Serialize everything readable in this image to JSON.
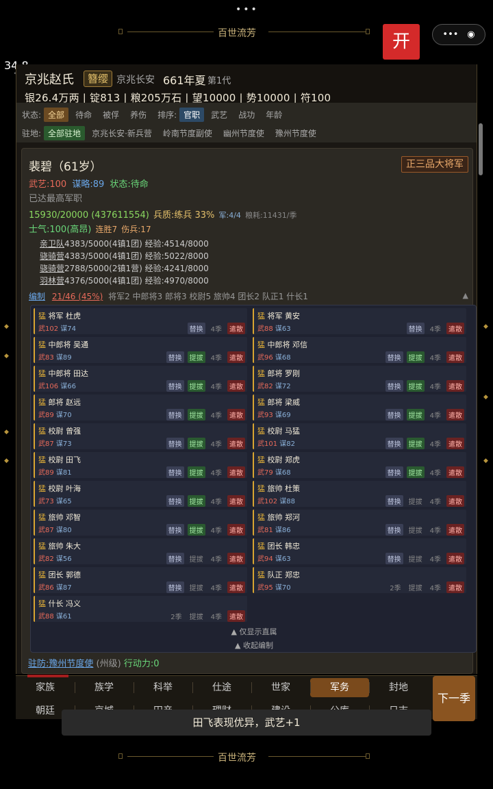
{
  "top": {
    "menu_dots": "•••",
    "title": "百世流芳",
    "open_button": "开",
    "capsule_more": "•••",
    "capsule_close": "◉",
    "temperature": "34.8",
    "temp_unit": "°C"
  },
  "header": {
    "clan": "京兆赵氏",
    "tag": "簪缨",
    "location": "京兆长安",
    "year": "661年夏",
    "generation": "第1代",
    "resources": "银26.4万两 | 锭813 | 粮205万石 | 望10000 | 势10000 | 符100"
  },
  "filters": {
    "status_label": "状态:",
    "status": [
      "全部",
      "待命",
      "被俘",
      "养伤"
    ],
    "sort_label": "排序:",
    "sort": [
      "官职",
      "武艺",
      "战功",
      "年龄"
    ],
    "garrison_label": "驻地:",
    "garrison": [
      "全部驻地",
      "京兆长安·新兵营",
      "岭南节度副使",
      "幽州节度使",
      "豫州节度使"
    ]
  },
  "general": {
    "name": "裴碧（61岁）",
    "rank": "正三品大将军",
    "wuyi": "武艺:100",
    "moulue": "谋略:89",
    "state": "状态:待命",
    "note": "已达最高军职",
    "troops_line": "15930/20000 (437611554)",
    "quality": "兵质:练兵 33%",
    "army": "军:4/4",
    "grain": "粮耗:11431/季",
    "morale": "士气:100(高昂)",
    "streak": "连胜7",
    "wounded": "伤兵:17",
    "units": [
      {
        "name": "亲卫队",
        "text": "4383/5000(4镇1团) 经验:4514/8000"
      },
      {
        "name": "骁骑营",
        "text": "4383/5000(4镇1团) 经验:5022/8000"
      },
      {
        "name": "骁骑营",
        "text": "2788/5000(2镇1营) 经验:4241/8000"
      },
      {
        "name": "羽林营",
        "text": "4376/5000(4镇1团) 经验:4970/8000"
      }
    ],
    "org_label": "编制",
    "org_count": "21/46 (45%)",
    "org_detail": "将军2 中郎将3 郎将3 校尉5 旅帅4 团长2 队正1 什长1",
    "collapse_arrow": "▲"
  },
  "officers": [
    {
      "badge": "猛",
      "title": "将军",
      "name": "杜虎",
      "wu": "武102",
      "mou": "谋74",
      "acts": [
        "替换"
      ],
      "season": "4季",
      "dismiss": "遣散"
    },
    {
      "badge": "猛",
      "title": "将军",
      "name": "黄安",
      "wu": "武88",
      "mou": "谋63",
      "acts": [
        "替换"
      ],
      "season": "4季",
      "dismiss": "遣散"
    },
    {
      "badge": "猛",
      "title": "中郎将",
      "name": "吴通",
      "wu": "武83",
      "mou": "谋89",
      "acts": [
        "替换",
        "提拔"
      ],
      "season": "4季",
      "dismiss": "遣散"
    },
    {
      "badge": "猛",
      "title": "中郎将",
      "name": "邓信",
      "wu": "武96",
      "mou": "谋68",
      "acts": [
        "替换",
        "提拔"
      ],
      "season": "4季",
      "dismiss": "遣散"
    },
    {
      "badge": "猛",
      "title": "中郎将",
      "name": "田达",
      "wu": "武106",
      "mou": "谋66",
      "acts": [
        "替换",
        "提拔"
      ],
      "season": "4季",
      "dismiss": "遣散"
    },
    {
      "badge": "猛",
      "title": "郎将",
      "name": "罗刚",
      "wu": "武82",
      "mou": "谋72",
      "acts": [
        "替换",
        "提拔"
      ],
      "season": "4季",
      "dismiss": "遣散"
    },
    {
      "badge": "猛",
      "title": "郎将",
      "name": "赵远",
      "wu": "武89",
      "mou": "谋70",
      "acts": [
        "替换",
        "提拔"
      ],
      "season": "4季",
      "dismiss": "遣散"
    },
    {
      "badge": "猛",
      "title": "郎将",
      "name": "梁威",
      "wu": "武93",
      "mou": "谋69",
      "acts": [
        "替换",
        "提拔"
      ],
      "season": "4季",
      "dismiss": "遣散"
    },
    {
      "badge": "猛",
      "title": "校尉",
      "name": "曾强",
      "wu": "武87",
      "mou": "谋73",
      "acts": [
        "替换",
        "提拔"
      ],
      "season": "4季",
      "dismiss": "遣散"
    },
    {
      "badge": "猛",
      "title": "校尉",
      "name": "马猛",
      "wu": "武101",
      "mou": "谋82",
      "acts": [
        "替换",
        "提拔"
      ],
      "season": "4季",
      "dismiss": "遣散"
    },
    {
      "badge": "猛",
      "title": "校尉",
      "name": "田飞",
      "wu": "武89",
      "mou": "谋81",
      "acts": [
        "替换",
        "提拔"
      ],
      "season": "4季",
      "dismiss": "遣散"
    },
    {
      "badge": "猛",
      "title": "校尉",
      "name": "郑虎",
      "wu": "武79",
      "mou": "谋68",
      "acts": [
        "替换",
        "提拔"
      ],
      "season": "4季",
      "dismiss": "遣散"
    },
    {
      "badge": "猛",
      "title": "校尉",
      "name": "叶海",
      "wu": "武73",
      "mou": "谋65",
      "acts": [
        "替换",
        "提拔"
      ],
      "season": "4季",
      "dismiss": "遣散"
    },
    {
      "badge": "猛",
      "title": "旅帅",
      "name": "杜策",
      "wu": "武102",
      "mou": "谋88",
      "acts": [
        "替换",
        "提拔0"
      ],
      "season": "4季",
      "dismiss": "遣散"
    },
    {
      "badge": "猛",
      "title": "旅帅",
      "name": "邓智",
      "wu": "武87",
      "mou": "谋80",
      "acts": [
        "替换",
        "提拔"
      ],
      "season": "4季",
      "dismiss": "遣散"
    },
    {
      "badge": "猛",
      "title": "旅帅",
      "name": "郑河",
      "wu": "武81",
      "mou": "谋86",
      "acts": [
        "替换",
        "提拔0"
      ],
      "season": "4季",
      "dismiss": "遣散"
    },
    {
      "badge": "猛",
      "title": "旅帅",
      "name": "朱大",
      "wu": "武82",
      "mou": "谋56",
      "acts": [
        "替换",
        "提拔0"
      ],
      "season": "4季",
      "dismiss": "遣散"
    },
    {
      "badge": "猛",
      "title": "团长",
      "name": "韩忠",
      "wu": "武94",
      "mou": "谋63",
      "acts": [
        "替换",
        "提拔0"
      ],
      "season": "4季",
      "dismiss": "遣散"
    },
    {
      "badge": "猛",
      "title": "团长",
      "name": "郭德",
      "wu": "武86",
      "mou": "谋87",
      "acts": [
        "替换",
        "提拔0"
      ],
      "season": "4季",
      "dismiss": "遣散"
    },
    {
      "badge": "猛",
      "title": "队正",
      "name": "郑忠",
      "wu": "武95",
      "mou": "谋70",
      "acts": [
        "2季",
        "提拔0"
      ],
      "season": "4季",
      "dismiss": "遣散"
    },
    {
      "badge": "猛",
      "title": "什长",
      "name": "冯义",
      "wu": "武88",
      "mou": "谋61",
      "acts": [
        "2季",
        "提拔0"
      ],
      "season": "4季",
      "dismiss": "遣散"
    }
  ],
  "sub_footer": {
    "direct_only": "▲ 仅显示直属",
    "collapse": "▲ 收起编制"
  },
  "garrison_line": {
    "link": "驻防:豫州节度使",
    "level": "(州级)",
    "action": "行动力:0"
  },
  "nav": {
    "row1": [
      "家族",
      "族学",
      "科举",
      "仕途",
      "世家",
      "军务",
      "封地"
    ],
    "row2": [
      "朝廷",
      "京城",
      "田产",
      "理财",
      "建设",
      "公库",
      "日志"
    ],
    "active": "军务",
    "next": "下一季"
  },
  "toast": "田飞表现优异，武艺+1",
  "bottom_title": "百世流芳"
}
